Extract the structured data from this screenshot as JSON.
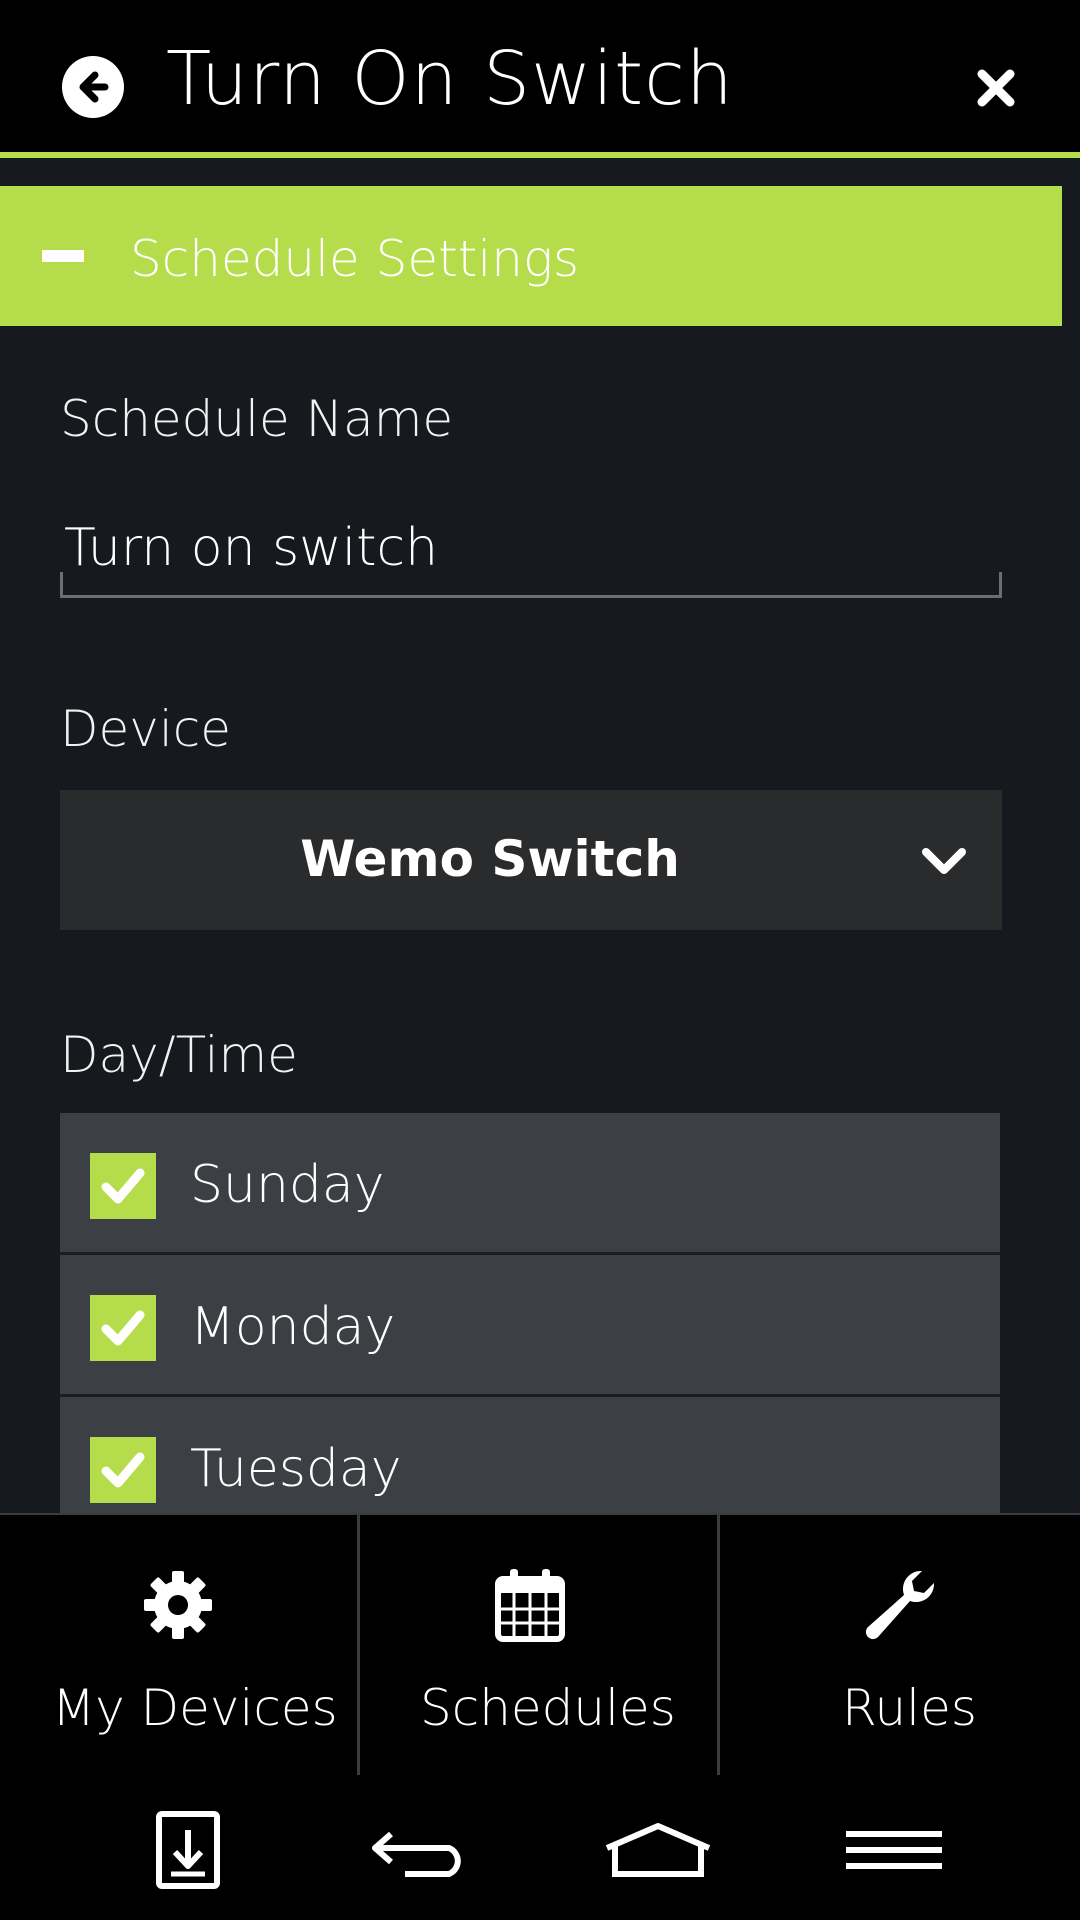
{
  "colors": {
    "accent": "#b5dc4b",
    "background": "#16191d",
    "row": "#3c3f44"
  },
  "header": {
    "title": "Turn On Switch",
    "back_icon": "arrow-left-circle-icon",
    "close_icon": "close-icon"
  },
  "section": {
    "label": "Schedule Settings",
    "toggle_icon": "minus-icon"
  },
  "form": {
    "schedule_name_label": "Schedule Name",
    "schedule_name_value": "Turn on switch",
    "device_label": "Device",
    "device_value": "Wemo Switch",
    "daytime_label": "Day/Time",
    "days": [
      {
        "label": "Sunday",
        "checked": true
      },
      {
        "label": "Monday",
        "checked": true
      },
      {
        "label": "Tuesday",
        "checked": true
      }
    ]
  },
  "tabs": [
    {
      "label": "My Devices",
      "icon": "gear-icon"
    },
    {
      "label": "Schedules",
      "icon": "calendar-icon"
    },
    {
      "label": "Rules",
      "icon": "wrench-icon"
    }
  ],
  "navbar": {
    "icons": [
      "download-icon",
      "back-icon",
      "home-icon",
      "menu-icon"
    ]
  }
}
